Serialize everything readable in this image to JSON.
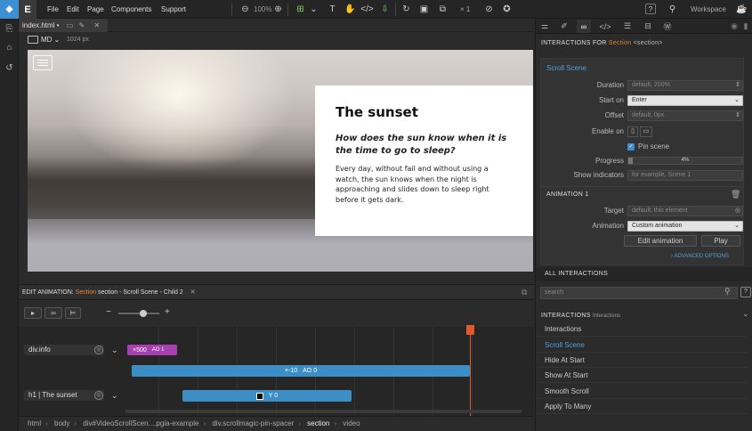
{
  "app": {
    "logo_letter": "E"
  },
  "menu": {
    "file": "File",
    "edit": "Edit",
    "page": "Page",
    "components": "Components",
    "support": "Support"
  },
  "toolbar": {
    "zoom": "100%",
    "scale": "× 1",
    "workspace": "Workspace",
    "help": "?"
  },
  "document": {
    "tab_name": "index.html •"
  },
  "device": {
    "breakpoint": "MD",
    "width": "1024 px"
  },
  "page": {
    "heading": "The sunset",
    "subheading": "How does the sun know when it is the time to go to sleep?",
    "body": "Every day, without fail and without using a watch, the sun knows when the night is approaching and slides down to sleep right before it gets dark."
  },
  "animation_bar": {
    "prefix": "EDIT ANIMATION:",
    "section": "Section",
    "rest": "section - Scroll Scene - Child 2",
    "close": "✕"
  },
  "timeline": {
    "rows": [
      {
        "label": "div.info",
        "chip_x": "×500",
        "chip_ao": "AO",
        "chip_ao_val": "1",
        "bar_x": "×-10",
        "bar_ao": "AO",
        "bar_ao_val": "0"
      },
      {
        "label": "h1 | The sunset",
        "bar_y": "Y",
        "bar_y_val": "0"
      }
    ],
    "playhead_fraction": 0.826
  },
  "breadcrumb": [
    "html",
    "body",
    "div#VideoScrollScen....pgia-example",
    "div.scrollmagic-pin-spacer",
    "section",
    "video"
  ],
  "right": {
    "header_prefix": "INTERACTIONS FOR",
    "header_el": "Section",
    "header_tag": "<section>",
    "scene_title": "Scroll Scene",
    "fields": {
      "duration_label": "Duration",
      "duration_ph": "default, 200%",
      "start_label": "Start on",
      "start_value": "Enter",
      "offset_label": "Offset",
      "offset_ph": "default, 0px",
      "enable_label": "Enable on",
      "pin_label": "Pin scene",
      "progress_label": "Progress",
      "progress_value": "4%",
      "indicators_label": "Show indicators",
      "indicators_ph": "for example, Scene 1"
    },
    "anim_title": "ANIMATION 1",
    "target_label": "Target",
    "target_ph": "default, this element",
    "animation_label": "Animation",
    "animation_value": "Custom animation",
    "edit_button": "Edit animation",
    "play_button": "Play",
    "advanced": "ADVANCED OPTIONS",
    "all_title": "ALL INTERACTIONS",
    "search_ph": "search",
    "inter_title": "INTERACTIONS",
    "inter_sub": "Interactions",
    "list": [
      "Interactions",
      "Scroll Scene",
      "Hide At Start",
      "Show At Start",
      "Smooth Scroll",
      "Apply To Many"
    ]
  }
}
